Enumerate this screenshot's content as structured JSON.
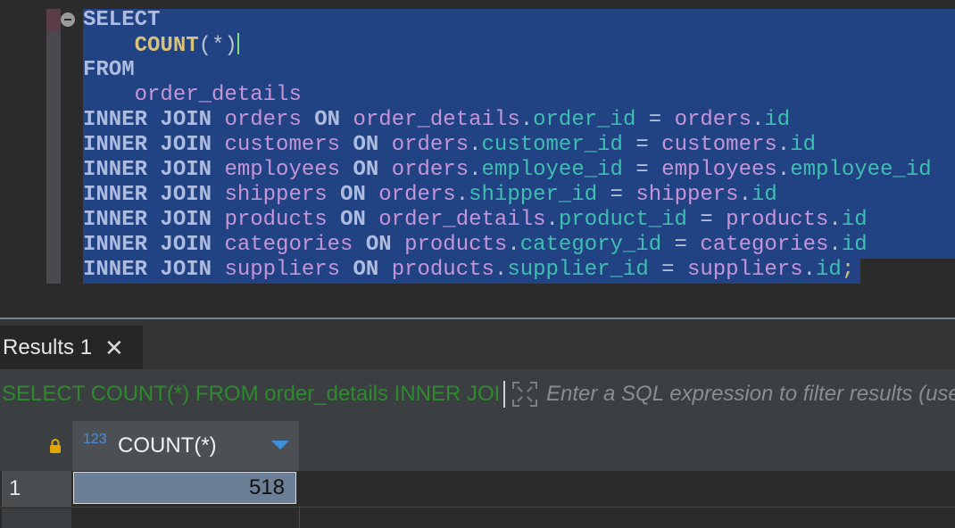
{
  "editor": {
    "lines": [
      [
        {
          "t": "SELECT",
          "c": "kw"
        }
      ],
      [
        {
          "t": "    COUNT",
          "c": "fn"
        },
        {
          "t": "(*)",
          "c": "op"
        },
        {
          "caret": true
        }
      ],
      [
        {
          "t": "FROM",
          "c": "kw"
        }
      ],
      [
        {
          "t": "    order_details",
          "c": "tb"
        }
      ],
      [
        {
          "t": "INNER JOIN ",
          "c": "kw"
        },
        {
          "t": "orders ",
          "c": "tb"
        },
        {
          "t": "ON ",
          "c": "kw"
        },
        {
          "t": "order_details",
          "c": "tb"
        },
        {
          "t": ".",
          "c": "op"
        },
        {
          "t": "order_id",
          "c": "cl"
        },
        {
          "t": " = ",
          "c": "op"
        },
        {
          "t": "orders",
          "c": "tb"
        },
        {
          "t": ".",
          "c": "op"
        },
        {
          "t": "id",
          "c": "cl"
        }
      ],
      [
        {
          "t": "INNER JOIN ",
          "c": "kw"
        },
        {
          "t": "customers ",
          "c": "tb"
        },
        {
          "t": "ON ",
          "c": "kw"
        },
        {
          "t": "orders",
          "c": "tb"
        },
        {
          "t": ".",
          "c": "op"
        },
        {
          "t": "customer_id",
          "c": "cl"
        },
        {
          "t": " = ",
          "c": "op"
        },
        {
          "t": "customers",
          "c": "tb"
        },
        {
          "t": ".",
          "c": "op"
        },
        {
          "t": "id",
          "c": "cl"
        }
      ],
      [
        {
          "t": "INNER JOIN ",
          "c": "kw"
        },
        {
          "t": "employees ",
          "c": "tb"
        },
        {
          "t": "ON ",
          "c": "kw"
        },
        {
          "t": "orders",
          "c": "tb"
        },
        {
          "t": ".",
          "c": "op"
        },
        {
          "t": "employee_id",
          "c": "cl"
        },
        {
          "t": " = ",
          "c": "op"
        },
        {
          "t": "employees",
          "c": "tb"
        },
        {
          "t": ".",
          "c": "op"
        },
        {
          "t": "employee_id",
          "c": "cl"
        }
      ],
      [
        {
          "t": "INNER JOIN ",
          "c": "kw"
        },
        {
          "t": "shippers ",
          "c": "tb"
        },
        {
          "t": "ON ",
          "c": "kw"
        },
        {
          "t": "orders",
          "c": "tb"
        },
        {
          "t": ".",
          "c": "op"
        },
        {
          "t": "shipper_id",
          "c": "cl"
        },
        {
          "t": " = ",
          "c": "op"
        },
        {
          "t": "shippers",
          "c": "tb"
        },
        {
          "t": ".",
          "c": "op"
        },
        {
          "t": "id",
          "c": "cl"
        }
      ],
      [
        {
          "t": "INNER JOIN ",
          "c": "kw"
        },
        {
          "t": "products ",
          "c": "tb"
        },
        {
          "t": "ON ",
          "c": "kw"
        },
        {
          "t": "order_details",
          "c": "tb"
        },
        {
          "t": ".",
          "c": "op"
        },
        {
          "t": "product_id",
          "c": "cl"
        },
        {
          "t": " = ",
          "c": "op"
        },
        {
          "t": "products",
          "c": "tb"
        },
        {
          "t": ".",
          "c": "op"
        },
        {
          "t": "id",
          "c": "cl"
        }
      ],
      [
        {
          "t": "INNER JOIN ",
          "c": "kw"
        },
        {
          "t": "categories ",
          "c": "tb"
        },
        {
          "t": "ON ",
          "c": "kw"
        },
        {
          "t": "products",
          "c": "tb"
        },
        {
          "t": ".",
          "c": "op"
        },
        {
          "t": "category_id",
          "c": "cl"
        },
        {
          "t": " = ",
          "c": "op"
        },
        {
          "t": "categories",
          "c": "tb"
        },
        {
          "t": ".",
          "c": "op"
        },
        {
          "t": "id",
          "c": "cl"
        }
      ],
      [
        {
          "t": "INNER JOIN ",
          "c": "kw"
        },
        {
          "t": "suppliers ",
          "c": "tb"
        },
        {
          "t": "ON ",
          "c": "kw"
        },
        {
          "t": "products",
          "c": "tb"
        },
        {
          "t": ".",
          "c": "op"
        },
        {
          "t": "supplier_id",
          "c": "cl"
        },
        {
          "t": " = ",
          "c": "op"
        },
        {
          "t": "suppliers",
          "c": "tb"
        },
        {
          "t": ".",
          "c": "op"
        },
        {
          "t": "id",
          "c": "cl"
        },
        {
          "t": ";",
          "c": "sm"
        }
      ]
    ]
  },
  "results": {
    "tab_label": "Results 1",
    "tab_close_icon": "close-icon",
    "query_text": "SELECT COUNT(*) FROM order_details INNER JOIN orders ON order_details.order_id = orders.id",
    "filter_placeholder": "Enter a SQL expression to filter results (use Ctrl+Space)",
    "columns": [
      {
        "type_badge": "123",
        "name": "COUNT(*)"
      }
    ],
    "rows": [
      {
        "num": "1",
        "values": [
          "518"
        ]
      }
    ]
  },
  "colors": {
    "keyword": "#aebddf",
    "function": "#d6c27b",
    "table": "#c595d8",
    "column": "#3fbfb0",
    "selection": "#214283",
    "query_green": "#2d8a2d"
  }
}
